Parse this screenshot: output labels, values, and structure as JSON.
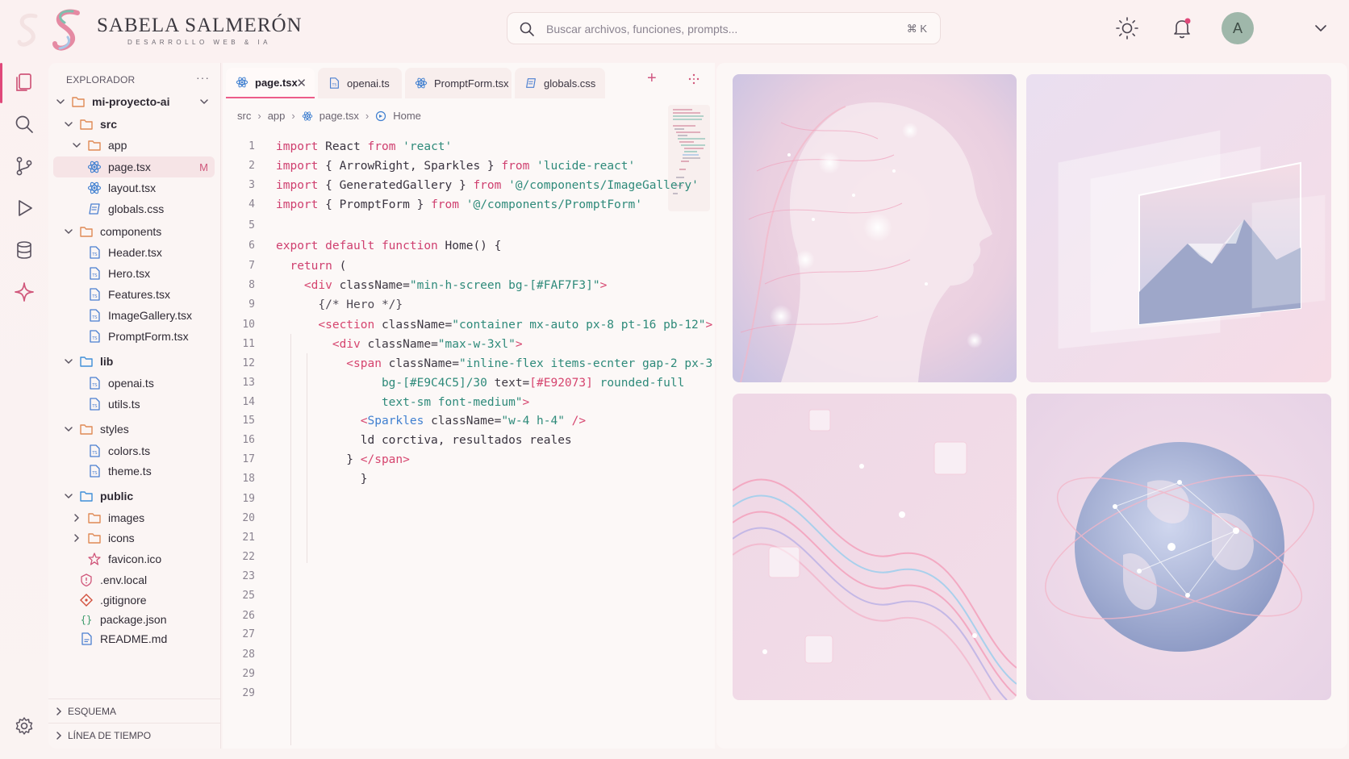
{
  "brand": {
    "name": "SABELA SALMERÓN",
    "tagline": "DESARROLLO WEB & IA"
  },
  "search": {
    "placeholder": "Buscar archivos, funciones, prompts...",
    "shortcut": "⌘ K"
  },
  "user": {
    "avatar_letter": "A"
  },
  "explorer": {
    "title": "EXPLORADOR",
    "more": "···",
    "tree": [
      {
        "label": "mi-proyecto-ai",
        "type": "folder",
        "depth": 0,
        "open": true,
        "bold": true
      },
      {
        "label": "src",
        "type": "folder",
        "depth": 1,
        "open": true,
        "bold": true
      },
      {
        "label": "app",
        "type": "folder",
        "depth": 2,
        "open": true
      },
      {
        "label": "page.tsx",
        "type": "react",
        "depth": 3,
        "selected": true,
        "badge": "M"
      },
      {
        "label": "layout.tsx",
        "type": "react",
        "depth": 3
      },
      {
        "label": "globals.css",
        "type": "css",
        "depth": 3
      },
      {
        "label": "components",
        "type": "folder",
        "depth": 1,
        "open": true
      },
      {
        "label": "Header.tsx",
        "type": "ts",
        "depth": 3
      },
      {
        "label": "Hero.tsx",
        "type": "ts",
        "depth": 3
      },
      {
        "label": "Features.tsx",
        "type": "ts",
        "depth": 3
      },
      {
        "label": "ImageGallery.tsx",
        "type": "ts",
        "depth": 3
      },
      {
        "label": "PromptForm.tsx",
        "type": "ts",
        "depth": 3
      },
      {
        "label": "lib",
        "type": "folder-blue",
        "depth": 1,
        "open": true,
        "bold": true
      },
      {
        "label": "openai.ts",
        "type": "ts",
        "depth": 3
      },
      {
        "label": "utils.ts",
        "type": "ts",
        "depth": 3
      },
      {
        "label": "styles",
        "type": "folder",
        "depth": 1,
        "open": true
      },
      {
        "label": "colors.ts",
        "type": "ts",
        "depth": 3
      },
      {
        "label": "theme.ts",
        "type": "ts",
        "depth": 3
      },
      {
        "label": "public",
        "type": "folder-blue",
        "depth": 1,
        "open": true,
        "bold": true
      },
      {
        "label": "images",
        "type": "folder",
        "depth": 2,
        "open": false
      },
      {
        "label": "icons",
        "type": "folder",
        "depth": 2,
        "open": false
      },
      {
        "label": "favicon.ico",
        "type": "star",
        "depth": 3
      },
      {
        "label": ".env.local",
        "type": "env",
        "depth": 1
      },
      {
        "label": ".gitignore",
        "type": "git",
        "depth": 1
      },
      {
        "label": "package.json",
        "type": "json",
        "depth": 1
      },
      {
        "label": "README.md",
        "type": "md",
        "depth": 1
      }
    ],
    "outline": "ESQUEMA",
    "timeline": "LÍNEA DE TIEMPO"
  },
  "tabs": [
    {
      "label": "page.tsx",
      "icon": "react",
      "active": true
    },
    {
      "label": "openai.ts",
      "icon": "ts"
    },
    {
      "label": "PromptForm.tsx",
      "icon": "react"
    },
    {
      "label": "globals.css",
      "icon": "css"
    }
  ],
  "breadcrumb": [
    "src",
    "app",
    "page.tsx",
    "Home"
  ],
  "line_numbers": [
    "1",
    "2",
    "3",
    "4",
    "5",
    "6",
    "7",
    "8",
    "9",
    "10",
    "11",
    "12",
    "13",
    "14",
    "15",
    "16",
    "17",
    "18",
    "19",
    "20",
    "21",
    "22",
    "23",
    "25",
    "26",
    "27",
    "28",
    "29",
    "29"
  ],
  "code": {
    "l1": [
      [
        "import",
        "kw"
      ],
      [
        " React ",
        ""
      ],
      [
        "from",
        "kw"
      ],
      [
        " 'react'",
        "str"
      ]
    ],
    "l2": [
      [
        "import",
        "kw"
      ],
      [
        " { ArrowRight, Sparkles } ",
        ""
      ],
      [
        "from",
        "kw"
      ],
      [
        " 'lucide-react'",
        "str"
      ]
    ],
    "l3": [
      [
        "import",
        "kw"
      ],
      [
        " { GeneratedGallery } ",
        ""
      ],
      [
        "from",
        "kw"
      ],
      [
        " '@/components/ImageGallery'",
        "str"
      ]
    ],
    "l4": [
      [
        "import",
        "kw"
      ],
      [
        " { PromptForm } ",
        ""
      ],
      [
        "from",
        "kw"
      ],
      [
        " '@/components/PromptForm'",
        "str"
      ]
    ],
    "l6": [
      [
        "export default function",
        "kw"
      ],
      [
        " Home() {",
        ""
      ]
    ],
    "l7": [
      [
        "  return",
        "kw"
      ],
      [
        " (",
        ""
      ]
    ],
    "l8": [
      [
        "    <div",
        "tag"
      ],
      [
        " className=",
        "attr"
      ],
      [
        "\"min-h-screen bg-[#FAF7F3]\"",
        "str"
      ],
      [
        ">",
        "tag"
      ]
    ],
    "l9": [
      [
        "      {/* Hero */}",
        "cmt"
      ]
    ],
    "l10": [
      [
        "      <section",
        "tag"
      ],
      [
        " className=",
        "attr"
      ],
      [
        "\"container mx-auto px-8 pt-16 pb-12\"",
        "str"
      ],
      [
        ">",
        "tag"
      ]
    ],
    "l11": [
      [
        "        <div",
        "tag"
      ],
      [
        " className=",
        "attr"
      ],
      [
        "\"max-w-3xl\"",
        "str"
      ],
      [
        ">",
        "tag"
      ]
    ],
    "l12": [
      [
        "          <span",
        "tag"
      ],
      [
        " className=",
        "attr"
      ],
      [
        "\"inline-flex items-ecnter gap-2 px-3 py-1",
        "str"
      ]
    ],
    "l13": [
      [
        "               bg-[#E9C4C5]/30 ",
        "str"
      ],
      [
        "text=",
        "attr"
      ],
      [
        "[#E92073]",
        "tag"
      ],
      [
        " rounded-full",
        "str"
      ]
    ],
    "l14": [
      [
        "               text-sm font-medium\"",
        "str"
      ],
      [
        ">",
        "tag"
      ]
    ],
    "l15": [
      [
        "            <",
        "tag"
      ],
      [
        "Sparkles",
        "cmp"
      ],
      [
        " className=",
        "attr"
      ],
      [
        "\"w-4 h-4\"",
        "str"
      ],
      [
        " />",
        "tag"
      ]
    ],
    "l16": [
      [
        "            ld corctiva, resultados reales",
        ""
      ]
    ],
    "l17": [
      [
        "          } ",
        ""
      ],
      [
        "</span>",
        "tag"
      ]
    ],
    "l18": [
      [
        "            }",
        ""
      ]
    ]
  },
  "gallery": [
    {
      "name": "ai-face-image",
      "alt": ""
    },
    {
      "name": "layered-landscape-image",
      "alt": ""
    },
    {
      "name": "data-wave-image",
      "alt": ""
    },
    {
      "name": "network-globe-image",
      "alt": ""
    }
  ],
  "colors": {
    "accent": "#E0487A",
    "bg": "#FBF1F1"
  }
}
